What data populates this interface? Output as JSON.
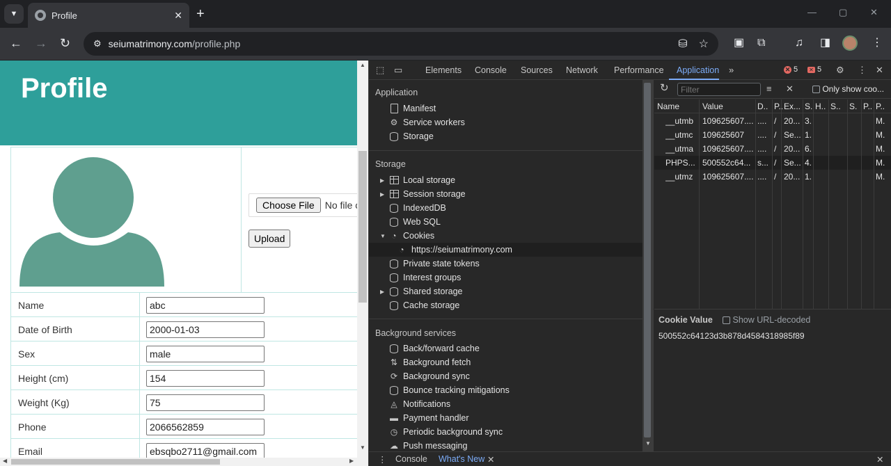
{
  "browser": {
    "tab_title": "Profile",
    "tab_close": "✕",
    "new_tab": "+",
    "url_host": "seiumatrimony.com",
    "url_path": "/profile.php",
    "window_minimize": "—",
    "window_restore": "▢",
    "window_close": "✕"
  },
  "page": {
    "header_title": "Profile",
    "file_button": "Choose File",
    "file_status": "No file chosen",
    "upload_button": "Upload",
    "fields": [
      {
        "label": "Name",
        "value": "abc"
      },
      {
        "label": "Date of Birth",
        "value": "2000-01-03"
      },
      {
        "label": "Sex",
        "value": "male"
      },
      {
        "label": "Height (cm)",
        "value": "154"
      },
      {
        "label": "Weight (Kg)",
        "value": "75"
      },
      {
        "label": "Phone",
        "value": "2066562859"
      },
      {
        "label": "Email",
        "value": "ebsqbo2711@gmail.com"
      }
    ]
  },
  "devtools": {
    "tabs": [
      "Elements",
      "Console",
      "Sources",
      "Network",
      "Performance",
      "Application"
    ],
    "active_tab": "Application",
    "error_count": "5",
    "issue_count": "5",
    "sidebar": {
      "application_title": "Application",
      "application_items": [
        "Manifest",
        "Service workers",
        "Storage"
      ],
      "storage_title": "Storage",
      "storage_items": [
        "Local storage",
        "Session storage",
        "IndexedDB",
        "Web SQL",
        "Cookies",
        "https://seiumatrimony.com",
        "Private state tokens",
        "Interest groups",
        "Shared storage",
        "Cache storage"
      ],
      "background_title": "Background services",
      "background_items": [
        "Back/forward cache",
        "Background fetch",
        "Background sync",
        "Bounce tracking mitigations",
        "Notifications",
        "Payment handler",
        "Periodic background sync",
        "Push messaging"
      ]
    },
    "cookies": {
      "filter_placeholder": "Filter",
      "only_show": "Only show coo...",
      "columns": [
        "Name",
        "Value",
        "D..",
        "P..",
        "Ex...",
        "S..",
        "H..",
        "S..",
        "S..",
        "P..",
        "P.."
      ],
      "rows": [
        [
          "__utmb",
          "109625607....",
          "....",
          "/",
          "20...",
          "3.",
          "",
          "",
          "",
          "",
          "M."
        ],
        [
          "__utmc",
          "109625607",
          "....",
          "/",
          "Se...",
          "1.",
          "",
          "",
          "",
          "",
          "M."
        ],
        [
          "__utma",
          "109625607....",
          "....",
          "/",
          "20...",
          "6.",
          "",
          "",
          "",
          "",
          "M."
        ],
        [
          "PHPS...",
          "500552c64...",
          "s...",
          "/",
          "Se...",
          "4.",
          "",
          "",
          "",
          "",
          "M."
        ],
        [
          "__utmz",
          "109625607....",
          "....",
          "/",
          "20...",
          "1.",
          "",
          "",
          "",
          "",
          "M."
        ]
      ],
      "selected_row": 3,
      "value_title": "Cookie Value",
      "show_decoded": "Show URL-decoded",
      "value_text": "500552c64123d3b878d4584318985f89"
    },
    "drawer": {
      "console": "Console",
      "whats_new": "What's New"
    }
  }
}
